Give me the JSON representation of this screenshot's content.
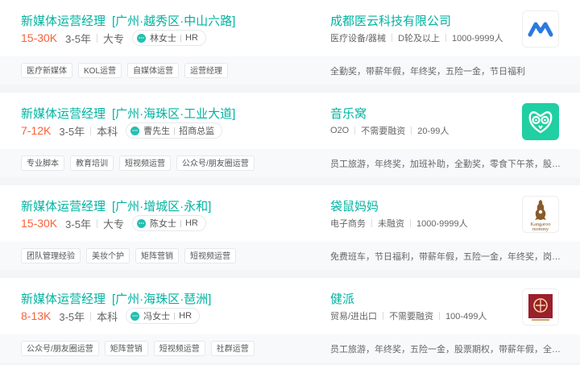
{
  "jobs": [
    {
      "title": "新媒体运营经理",
      "location": "[广州·越秀区·中山六路]",
      "salary": "15-30K",
      "experience": "3-5年",
      "education": "大专",
      "recruiter_name": "林女士",
      "recruiter_role": "HR",
      "company": "成都医云科技有限公司",
      "industry": "医疗设备/器械",
      "financing": "D轮及以上",
      "size": "1000-9999人",
      "tags": [
        "医疗新媒体",
        "KOL运营",
        "自媒体运营",
        "运营经理"
      ],
      "benefits": "全勤奖，带薪年假，年终奖，五险一金，节日福利",
      "logo_icon": "company-m-logo",
      "logo_color": "#2a7ae2"
    },
    {
      "title": "新媒体运营经理",
      "location": "[广州·海珠区·工业大道]",
      "salary": "7-12K",
      "experience": "3-5年",
      "education": "本科",
      "recruiter_name": "曹先生",
      "recruiter_role": "招商总监",
      "company": "音乐窝",
      "industry": "O2O",
      "financing": "不需要融资",
      "size": "20-99人",
      "tags": [
        "专业脚本",
        "教育培训",
        "短视频运营",
        "公众号/朋友圈运营"
      ],
      "benefits": "员工旅游，年终奖，加班补助，全勤奖，零食下午茶，股票期权",
      "logo_icon": "owl-logo",
      "logo_color": "#20cfa2"
    },
    {
      "title": "新媒体运营经理",
      "location": "[广州·增城区·永和]",
      "salary": "15-30K",
      "experience": "3-5年",
      "education": "大专",
      "recruiter_name": "陈女士",
      "recruiter_role": "HR",
      "company": "袋鼠妈妈",
      "industry": "电子商务",
      "financing": "未融资",
      "size": "1000-9999人",
      "tags": [
        "团队管理经验",
        "美妆个护",
        "矩阵营销",
        "短视频运营"
      ],
      "benefits": "免费班车，节日福利，带薪年假，五险一金，年终奖，岗位晋升",
      "logo_icon": "kangaroo-logo",
      "logo_text_1": "Kangaroo",
      "logo_text_2": "mommy",
      "logo_color": "#8a5a2b"
    },
    {
      "title": "新媒体运营经理",
      "location": "[广州·海珠区·琶洲]",
      "salary": "8-13K",
      "experience": "3-5年",
      "education": "本科",
      "recruiter_name": "冯女士",
      "recruiter_role": "HR",
      "company": "健派",
      "industry": "贸易/进出口",
      "financing": "不需要融资",
      "size": "100-499人",
      "tags": [
        "公众号/朋友圈运营",
        "矩阵营销",
        "短视频运营",
        "社群运营"
      ],
      "benefits": "员工旅游，年终奖，五险一金，股票期权，带薪年假，全勤奖",
      "logo_icon": "red-seal-logo",
      "logo_color": "#9c1f2c"
    }
  ]
}
